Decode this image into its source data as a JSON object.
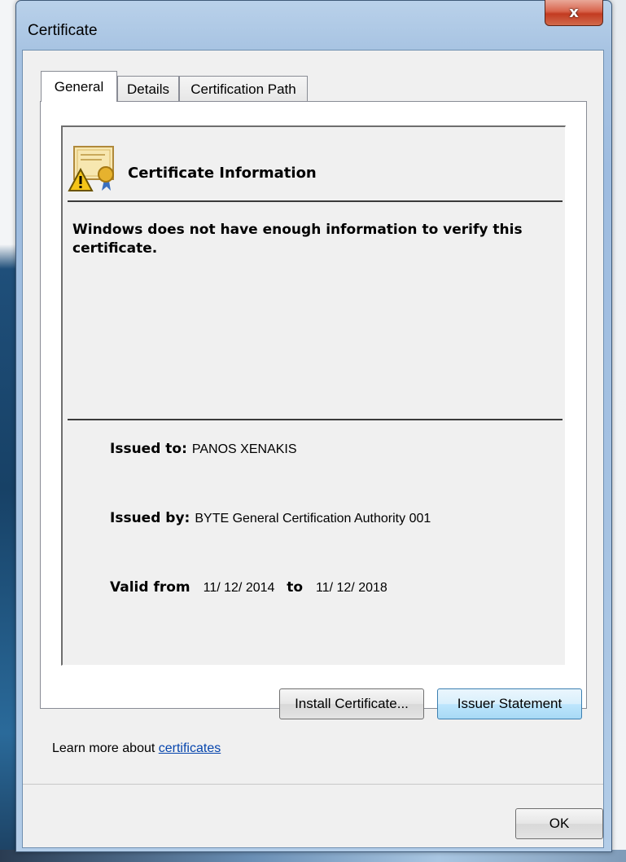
{
  "window": {
    "title": "Certificate",
    "close_glyph": "x"
  },
  "tabs": [
    {
      "label": "General",
      "active": true
    },
    {
      "label": "Details",
      "active": false
    },
    {
      "label": "Certification Path",
      "active": false
    }
  ],
  "info": {
    "icon": "certificate-warning-icon",
    "title": "Certificate Information",
    "warning": "Windows does not have enough information to verify this certificate."
  },
  "fields": {
    "issued_to_label": "Issued to:",
    "issued_to": "PANOS XENAKIS",
    "issued_by_label": "Issued by:",
    "issued_by": "BYTE General Certification Authority 001",
    "valid_from_label": "Valid from",
    "valid_from": "11/ 12/ 2014",
    "to_label": "to",
    "valid_to": "11/ 12/ 2018"
  },
  "buttons": {
    "install": "Install Certificate...",
    "issuer": "Issuer Statement",
    "ok": "OK"
  },
  "learn_more": {
    "prefix": "Learn more about ",
    "link": "certificates"
  }
}
